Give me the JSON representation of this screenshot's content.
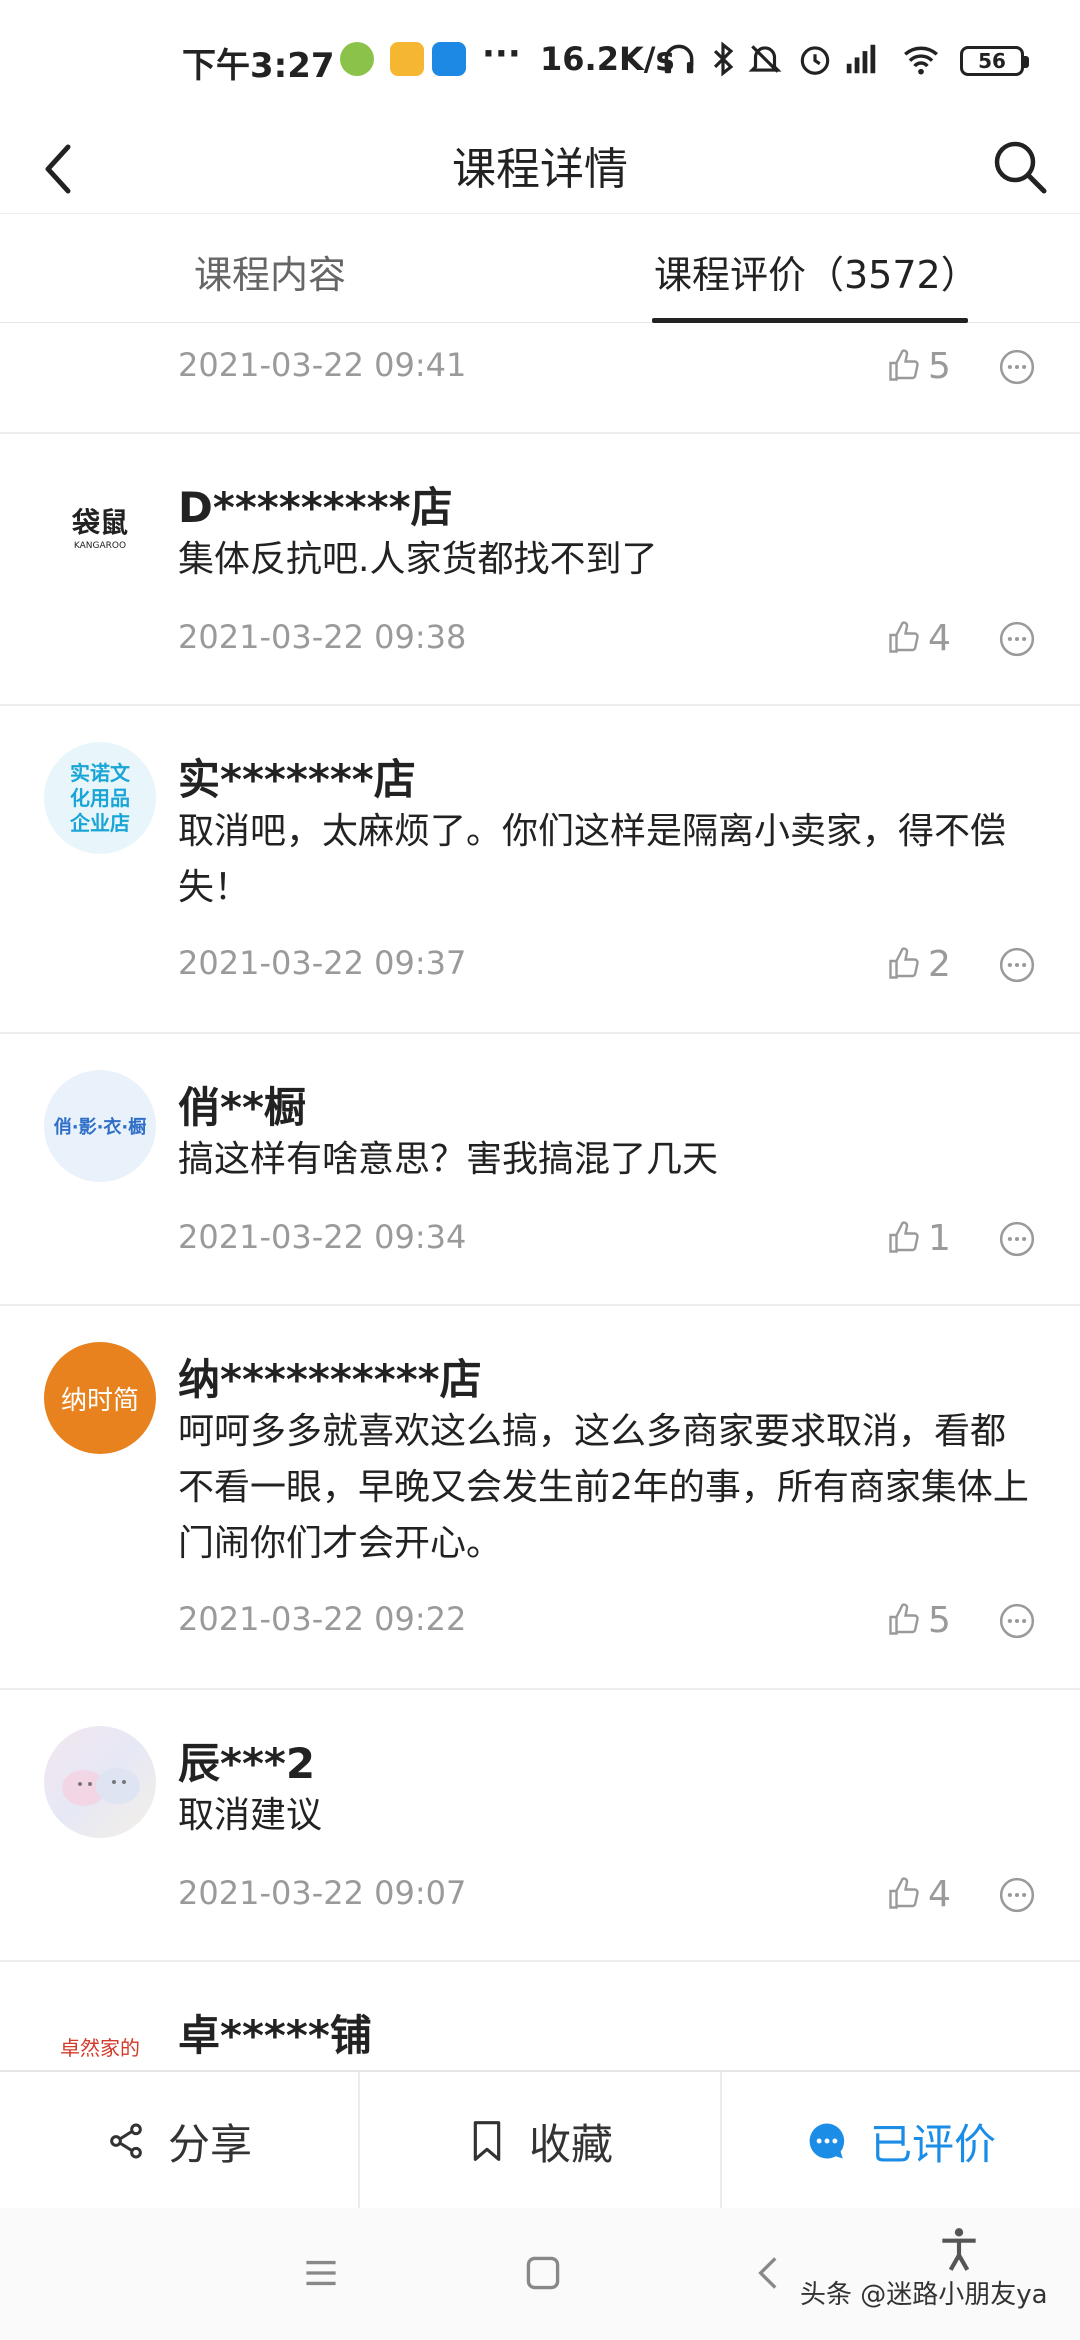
{
  "status_bar": {
    "time": "下午3:27",
    "speed": "16.2K/s",
    "battery": "56"
  },
  "header": {
    "title": "课程详情"
  },
  "tabs": [
    {
      "label": "课程内容"
    },
    {
      "label": "课程评价（3572）"
    }
  ],
  "reviews": [
    {
      "name": "",
      "avatar_text": "",
      "text": "",
      "date": "2021-03-22 09:41",
      "likes": "5"
    },
    {
      "name": "D*********店",
      "avatar_text": "袋鼠",
      "avatar_sub": "KANGAROO",
      "text": "集体反抗吧.人家货都找不到了",
      "date": "2021-03-22 09:38",
      "likes": "4"
    },
    {
      "name": "实*******店",
      "avatar_text": "实诺文化用品企业店",
      "text": "取消吧，太麻烦了。你们这样是隔离小卖家，得不偿失！",
      "date": "2021-03-22 09:37",
      "likes": "2"
    },
    {
      "name": "俏**橱",
      "avatar_text": "俏·影·衣·橱",
      "text": "搞这样有啥意思？害我搞混了几天",
      "date": "2021-03-22 09:34",
      "likes": "1"
    },
    {
      "name": "纳**********店",
      "avatar_text": "纳时简",
      "text": "呵呵多多就喜欢这么搞，这么多商家要求取消，看都不看一眼，早晚又会发生前2年的事，所有商家集体上门闹你们才会开心。",
      "date": "2021-03-22 09:22",
      "likes": "5"
    },
    {
      "name": "辰***2",
      "avatar_text": "",
      "text": "取消建议",
      "date": "2021-03-22 09:07",
      "likes": "4"
    },
    {
      "name": "卓*****铺",
      "avatar_text": "卓然家的",
      "text": "",
      "date": "",
      "likes": ""
    }
  ],
  "actions": {
    "share": "分享",
    "favorite": "收藏",
    "reviewed": "已评价"
  },
  "watermark": "头条 @迷路小朋友ya",
  "colors": {
    "accent": "#1b8de6",
    "avatar_orange": "#e8821e"
  }
}
